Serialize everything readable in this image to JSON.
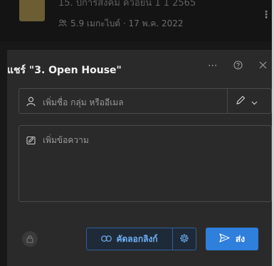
{
  "background_file": {
    "title": "15. ปิการสงคม ควอยน 1 1 2565",
    "meta": "5.9 เมกะไบต์ · 17 พ.ค. 2022",
    "icon_people": "people-icon",
    "icon_more": "more-vertical-icon"
  },
  "share_panel": {
    "title": "แชร์ \"3. Open House\"",
    "header_icons": {
      "more": "more-horizontal-icon",
      "help": "help-icon",
      "close": "close-icon"
    },
    "people_field": {
      "placeholder": "เพิ่มชื่อ กลุ่ม หรืออีเมล",
      "person_icon": "person-icon",
      "permission_icon": "pencil-icon",
      "dropdown_icon": "chevron-down-icon"
    },
    "message_field": {
      "placeholder": "เพิ่มข้อความ",
      "icon": "message-edit-icon"
    },
    "footer": {
      "lock_icon": "lock-icon",
      "copy_link_label": "คัดลอกลิงก์",
      "copy_link_icon": "link-icon",
      "link_settings_icon": "gear-icon",
      "send_label": "ส่ง",
      "send_icon": "send-icon"
    }
  },
  "colors": {
    "panel_bg": "#2a2a2a",
    "accent": "#2f7fdc",
    "link_text": "#6fb0f6"
  }
}
